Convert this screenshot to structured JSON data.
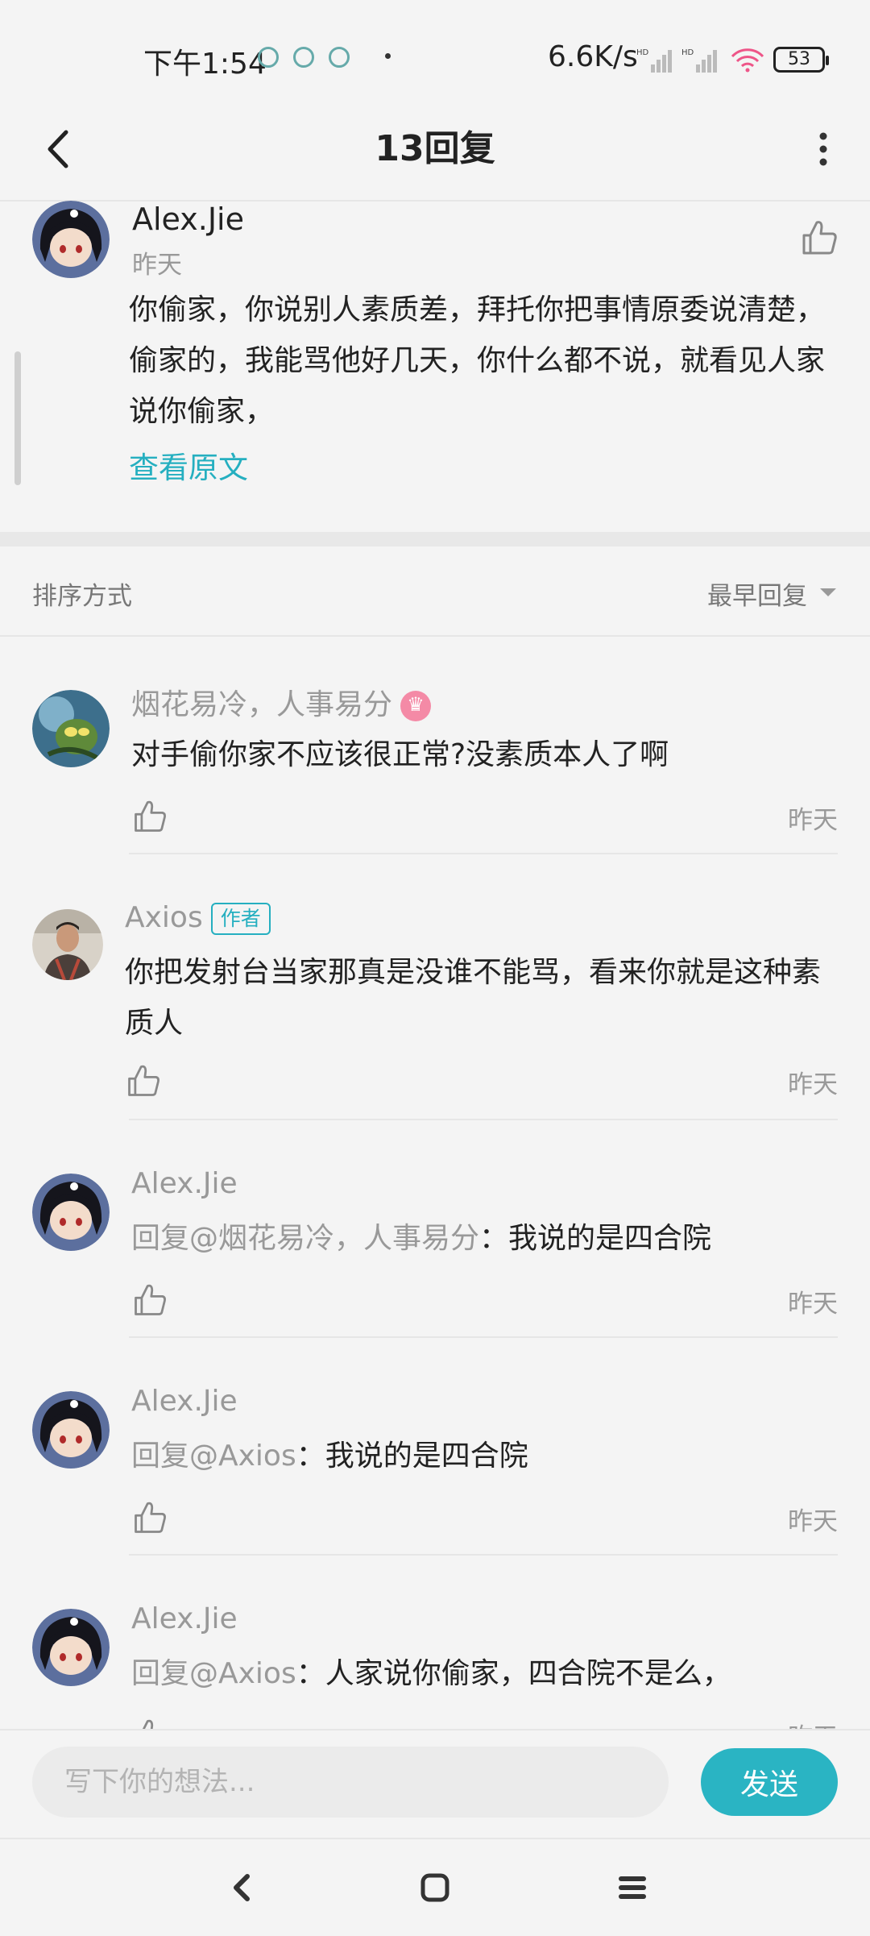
{
  "status_bar": {
    "time": "下午1:54",
    "network_speed": "6.6K/s",
    "battery": "53",
    "icons": [
      "app-notify-icon-1",
      "app-notify-icon-2",
      "app-notify-icon-3",
      "signal-hd-icon-1",
      "signal-hd-icon-2",
      "wifi-icon",
      "battery-icon"
    ]
  },
  "header": {
    "title": "13回复"
  },
  "main_comment": {
    "author": "Alex.Jie",
    "time": "昨天",
    "text": "你偷家，你说别人素质差，拜托你把事情原委说清楚，偷家的，我能骂他好几天，你什么都不说，就看见人家说你偷家，",
    "view_original": "查看原文"
  },
  "sort": {
    "label": "排序方式",
    "value": "最早回复"
  },
  "replies": [
    {
      "author": "烟花易冷，人事易分",
      "text": "对手偷你家不应该很正常?没素质本人了啊",
      "time": "昨天"
    },
    {
      "author": "Axios",
      "badge": "作者",
      "text": "你把发射台当家那真是没谁不能骂，看来你就是这种素质人",
      "time": "昨天"
    },
    {
      "author": "Alex.Jie",
      "mention": "回复@烟花易冷，人事易分",
      "text": "：我说的是四合院",
      "time": "昨天"
    },
    {
      "author": "Alex.Jie",
      "mention": "回复@Axios",
      "text": "：我说的是四合院",
      "time": "昨天"
    },
    {
      "author": "Alex.Jie",
      "mention": "回复@Axios",
      "text": "：人家说你偷家，四合院不是么，",
      "time": "昨天"
    }
  ],
  "composer": {
    "placeholder": "写下你的想法...",
    "send_label": "发送"
  },
  "colors": {
    "accent": "#2ab4c3",
    "background": "#f4f4f4",
    "muted_text": "#999999"
  }
}
